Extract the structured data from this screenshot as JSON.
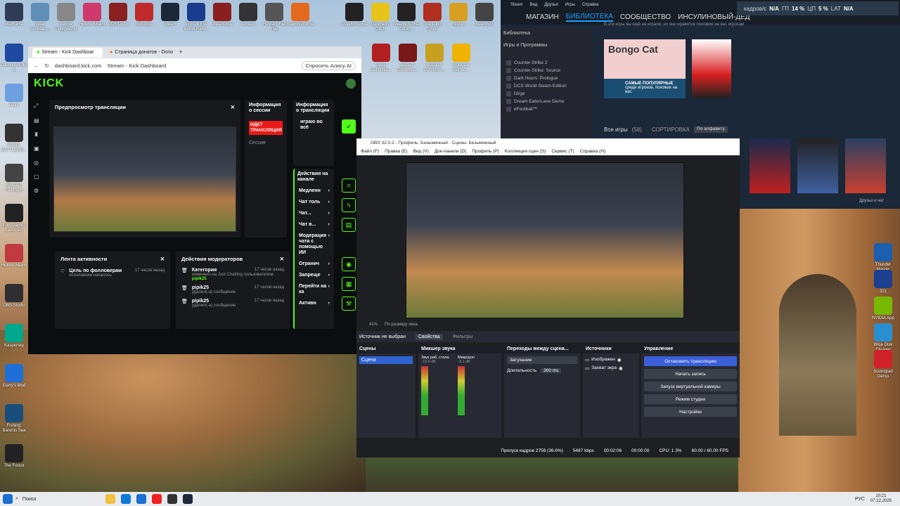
{
  "desktop_icons": [
    {
      "label": "Warframe",
      "color": "#2f3c55"
    },
    {
      "label": "Goat Simulato...",
      "color": "#5f8fb8"
    },
    {
      "label": "People Playground",
      "color": "#888"
    },
    {
      "label": "Hotline Miami",
      "color": "#d03a6a"
    },
    {
      "label": "POSTAL 2",
      "color": "#8a2020"
    },
    {
      "label": "BeLoga",
      "color": "#c02a2a"
    },
    {
      "label": "Steam",
      "color": "#1b2838"
    },
    {
      "label": "WRC 9 FIA World Rally...",
      "color": "#1a3c8f"
    },
    {
      "label": "DeadCore",
      "color": "#8a1f1f"
    },
    {
      "label": "Arma 3",
      "color": "#333"
    },
    {
      "label": "Human: Fall Flat",
      "color": "#555"
    },
    {
      "label": "BeamNG.drive",
      "color": "#e56a1d"
    },
    {
      "label": "Assetto Corsa",
      "color": "#222"
    },
    {
      "label": "Geometry Dash",
      "color": "#e8c41a"
    },
    {
      "label": "Assetto Corsa Comp...",
      "color": "#222"
    },
    {
      "label": "The Long Drive",
      "color": "#b03020"
    },
    {
      "label": "Bigsill",
      "color": "#d8a020"
    },
    {
      "label": "BeamNG",
      "color": "#444"
    }
  ],
  "left_icons": [
    {
      "label": "Counter-Strike 2",
      "color": "#1d4aa0"
    },
    {
      "label": "Paint",
      "color": "#6ea0e0"
    },
    {
      "label": "PUBG: BATTLEGR...",
      "color": "#333"
    },
    {
      "label": "Russian Fishing 4",
      "color": "#444"
    },
    {
      "label": "Epic Games Launcher",
      "color": "#222"
    },
    {
      "label": "Hotline Miami",
      "color": "#c03a40"
    },
    {
      "label": "OBS Studio",
      "color": "#302e31"
    },
    {
      "label": "Kaspersky",
      "color": "#00a88e"
    },
    {
      "label": "Garry's Mod",
      "color": "#1d6fd6"
    },
    {
      "label": "Fishing: Barents Sea",
      "color": "#1a4e7a"
    },
    {
      "label": "The Forest",
      "color": "#222"
    }
  ],
  "right_icons": [
    {
      "label": "Thunder Master",
      "color": "#1a5fb0"
    },
    {
      "label": "321",
      "color": "#1c3f8f"
    },
    {
      "label": "NVIDIA App",
      "color": "#76b900"
    },
    {
      "label": "Wise Disk Cleaner",
      "color": "#2a8fd0"
    },
    {
      "label": "Soundpad Demo",
      "color": "#d0202a"
    }
  ],
  "mafia_icons": [
    {
      "label": "Mafia: Definitive...",
      "color": "#b02020"
    },
    {
      "label": "Mafia II: Definitive...",
      "color": "#7a1818"
    },
    {
      "label": "Mafia III: Definitive...",
      "color": "#c8a020"
    },
    {
      "label": "Rockstar Games...",
      "color": "#f0b400"
    }
  ],
  "browser": {
    "tabs": [
      "Stream - Kick Dashboar",
      "Страница донатов - Dono"
    ],
    "url": "dashboard.kick.com",
    "page_title": "Stream - Kick Dashboard",
    "alice": "Спросить Алису AI",
    "logo": "KICK",
    "preview_title": "Предпросмотр трансляции",
    "session_title": "Информация о сессии",
    "live_badge": "ИДЕТ ТРАНСЛЯЦИЯ",
    "session_label": "Сессия",
    "stream_info_title": "Информация о трансляции",
    "stream_game": "играю во всё",
    "actions_title": "Действия на канале",
    "actions": [
      "Медленн",
      "Чат толь",
      "Чат...",
      "Чат в...",
      "Модерация чата с помощью ИИ",
      "Огранич",
      "Запреще",
      "Перейти на ка",
      "Активн"
    ],
    "activity_title": "Лента активности",
    "activity_item": "Цель по фолловерам",
    "activity_time": "17 часов назад",
    "activity_sub": "исполнение началось",
    "mod_title": "Действия модераторов",
    "mod_items": [
      {
        "title": "Категория",
        "time": "17 часов назад",
        "line1": "изменено на Just Chatting пользователем",
        "line2": "pipik25"
      },
      {
        "title": "pipik25",
        "time": "17 часов назад",
        "line1": "удалил(-а) сообщение",
        "line2": ""
      },
      {
        "title": "pipik25",
        "time": "17 часов назад",
        "line1": "удалил(-а) сообщение",
        "line2": ""
      }
    ]
  },
  "steam": {
    "top": [
      "Steam",
      "Вид",
      "Друзья",
      "Игры",
      "Справка"
    ],
    "nav": [
      "МАГАЗИН",
      "БИБЛИОТЕКА",
      "СООБЩЕСТВО",
      "ИНСУЛИНОВЫЙ-ДЕД"
    ],
    "user": "инсулиновый-дед",
    "home": "Библиотека",
    "filter": "Игры и Программы",
    "games": [
      "Counter-Strike 2",
      "Counter-Strike: Source",
      "Dark Hours: Prologue",
      "DCS World Steam Edition",
      "Dirge",
      "Dream Eaters.exe Demo",
      "eFootball™"
    ],
    "shelf_text": "В эти игры вы ещё не играли, но они нравятся похожим на вас игрокам",
    "bongo": "Bongo Cat",
    "popular": "САМЫЕ ПОПУЛЯРНЫЕ",
    "popular_sub": "среди игроков, похожих на вас",
    "all_games": "Все игры",
    "all_count": "(58)",
    "sort": "СОРТИРОВКА",
    "sort_val": "По алфавиту",
    "friends": "Друзья и чат",
    "overlay": [
      "кадров/с",
      "N/A",
      "ГП",
      "14 %",
      "ЦП",
      "5 %",
      "LAT",
      "N/A"
    ]
  },
  "obs": {
    "title": "OBS 32.0.2 - Профиль: Безымянный - Сцены: Безымянный",
    "menu": [
      "Файл (F)",
      "Правка (E)",
      "Вид (V)",
      "Док-панели (D)",
      "Профиль (P)",
      "Коллекция сцен (S)",
      "Сервис (T)",
      "Справка (H)"
    ],
    "zoom": "41%",
    "fit": "По размеру окна",
    "nosource": "Источник не выбран",
    "props": "Свойства",
    "filters": "Фильтры",
    "docks": [
      "Сцены",
      "Микшер звука",
      "Переходы между сцена...",
      "Источники",
      "Управление"
    ],
    "scene": "Сцена",
    "mixer": [
      {
        "name": "Звук раб. стола",
        "db": "-10.0 dB"
      },
      {
        "name": "Микр/доп",
        "db": "-3.1 dB"
      }
    ],
    "transition": "Затухание",
    "duration_label": "Длительность",
    "duration": "300 ms",
    "sources": [
      "Изображен",
      "Захват экра"
    ],
    "controls": [
      "Остановить трансляцию",
      "Начать запись",
      "Запуск виртуальной камеры",
      "Режим студии",
      "Настройки"
    ],
    "status": [
      "Пропуск кадров 2758 (36.6%)",
      "5487 kbps",
      "00:02:06",
      "00:00:00",
      "CPU: 1.3%",
      "60.00 / 60.00 FPS"
    ]
  },
  "taskbar": {
    "search": "Поиск",
    "lang": "РУС",
    "time": "10:21",
    "date": "07.12.2025"
  }
}
